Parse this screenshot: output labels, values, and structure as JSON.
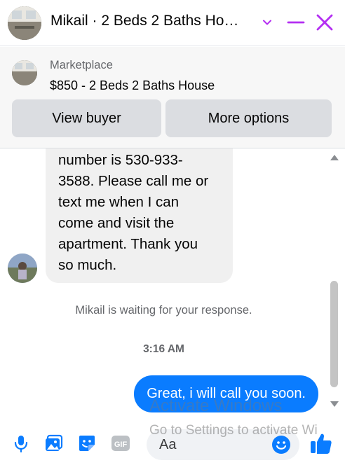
{
  "header": {
    "title": "Mikail · 2 Beds 2 Baths Ho…",
    "chevron_icon": "chevron-down-icon",
    "minimize_icon": "minimize-icon",
    "close_icon": "close-icon",
    "accent_color": "#b42ef2"
  },
  "marketplace": {
    "label": "Marketplace",
    "listing": "$850 - 2 Beds 2 Baths House",
    "view_buyer_label": "View buyer",
    "more_options_label": "More options"
  },
  "messages": {
    "incoming": {
      "lines": [
        "number is 530-933-",
        "3588. Please call me or",
        "text me when I can",
        "come and visit the",
        "apartment. Thank you",
        "so much."
      ]
    },
    "waiting_notice": "Mikail is waiting for your response.",
    "timestamp": "3:16 AM",
    "outgoing": {
      "text": "Great, i will call you soon.",
      "color": "#0a7cff"
    }
  },
  "watermark": {
    "line1": "Activate Windows",
    "line2": "Go to Settings to activate Wi"
  },
  "composer": {
    "placeholder": "Aa",
    "icons": [
      "microphone-icon",
      "photo-icon",
      "sticker-icon",
      "gif-icon",
      "emoji-icon",
      "like-icon"
    ],
    "gif_label": "GIF",
    "icon_color": "#0a7cff"
  }
}
